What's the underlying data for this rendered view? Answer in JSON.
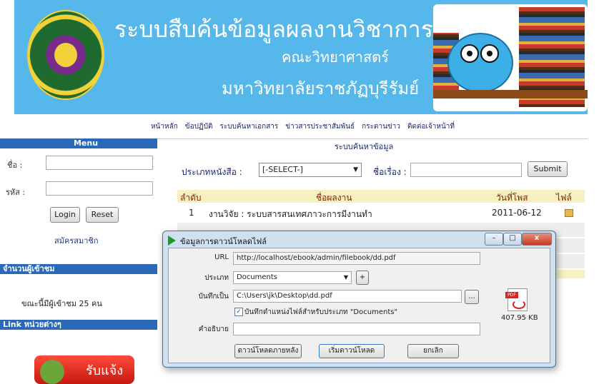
{
  "header": {
    "title": "ระบบสืบค้นข้อมูลผลงานวิชาการ",
    "faculty": "คณะวิทยาศาสตร์",
    "university": "มหาวิทยาลัยราชภัฏบุรีรัมย์"
  },
  "nav": [
    "หน้าหลัก",
    "ข้อปฏิบัติ",
    "ระบบค้นหาเอกสาร",
    "ข่าวสารประชาสัมพันธ์",
    "กระดานข่าว",
    "ติดต่อเจ้าหน้าที่"
  ],
  "sidebar": {
    "menu_title": "Menu",
    "name_label": "ชื่อ :",
    "password_label": "รหัส :",
    "login_button": "Login",
    "reset_button": "Reset",
    "register_link": "สมัครสมาชิก",
    "visitors_title": "จำนวนผู้เข้าชม",
    "visitors_text": "ขณะนี้มีผู้เข้าชม 25 คน",
    "links_title": "Link หน่วยต่างๆ",
    "banner_text": "รับแจ้ง"
  },
  "search": {
    "title": "ระบบค้นหาข้อมูล",
    "book_type_label": "ประเภทหนังสือ :",
    "book_type_value": "[-SELECT-]",
    "subject_label": "ชื่อเรื่อง :",
    "submit": "Submit"
  },
  "table": {
    "headers": [
      "ลำดับ",
      "ชื่อผลงาน",
      "วันที่โพส",
      "ไฟล์"
    ],
    "rows": [
      {
        "no": "1",
        "title": "งานวิจัย : ระบบสารสนเทศภาวะการมีงานทำ",
        "date": "2011-06-12"
      }
    ]
  },
  "dialog": {
    "title": "ข้อมูลการดาวน์โหลดไฟล์",
    "url_label": "URL",
    "url_value": "http://localhost/ebook/admin/filebook/dd.pdf",
    "type_label": "ประเภท",
    "type_value": "Documents",
    "plus": "+",
    "save_as_label": "บันทึกเป็น",
    "save_as_value": "C:\\Users\\jk\\Desktop\\dd.pdf",
    "browse": "...",
    "remember_label": "บันทึกตำแหน่งไฟล์สำหรับประเภท \"Documents\"",
    "remember_checked": true,
    "description_label": "คำอธิบาย",
    "description_value": "",
    "download_later": "ดาวน์โหลดภายหลัง",
    "start_download": "เริ่มดาวน์โหลด",
    "cancel": "ยกเลิก",
    "file_size": "407.95 KB",
    "minimize": "–",
    "maximize": "□",
    "close": "x"
  }
}
